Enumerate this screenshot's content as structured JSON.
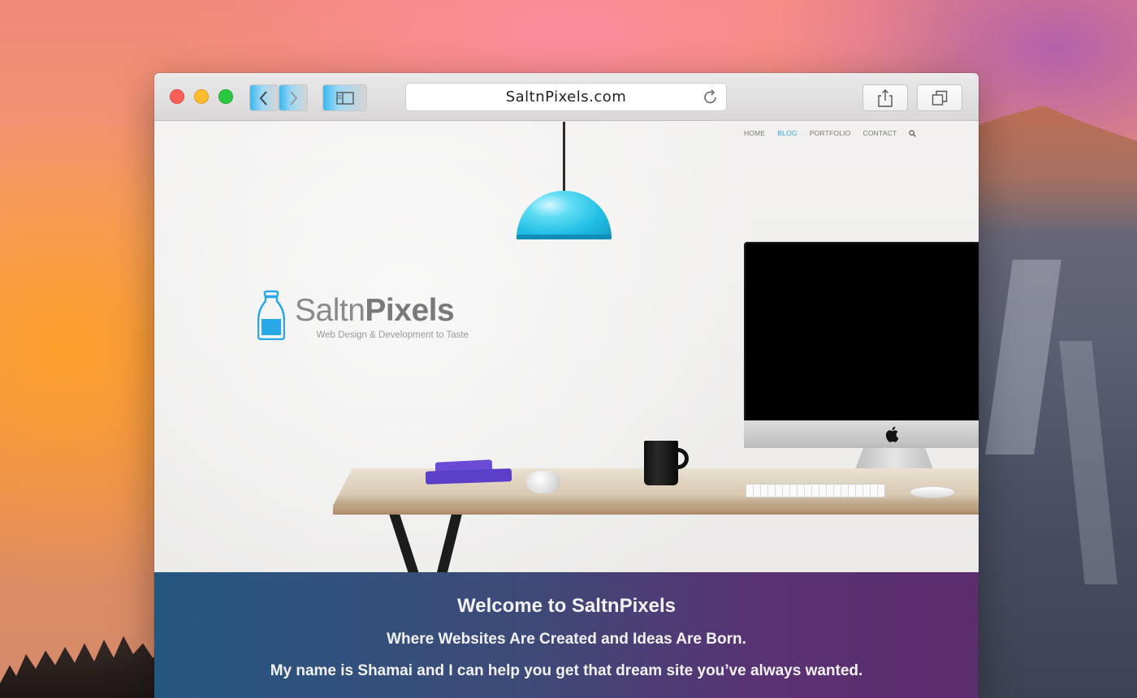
{
  "browser": {
    "url": "SaltnPixels.com"
  },
  "site": {
    "nav": [
      "HOME",
      "BLOG",
      "PORTFOLIO",
      "CONTACT"
    ],
    "active_nav": "BLOG",
    "logo": {
      "name_light": "Saltn",
      "name_bold": "Pixels",
      "tagline": "Web Design & Development to Taste"
    },
    "welcome": {
      "title": "Welcome to SaltnPixels",
      "line1": "Where Websites Are Created and Ideas Are Born.",
      "line2": "My name is Shamai and I can help you get that dream site you’ve always wanted."
    }
  },
  "colors": {
    "accent": "#29a8e6",
    "lamp": "#22bfe4",
    "band_start": "#24577f",
    "band_end": "#5a2d6e"
  },
  "icons": [
    "back-icon",
    "forward-icon",
    "sidebar-icon",
    "reload-icon",
    "share-icon",
    "tabs-icon",
    "search-icon",
    "salt-shaker-icon",
    "apple-icon"
  ]
}
